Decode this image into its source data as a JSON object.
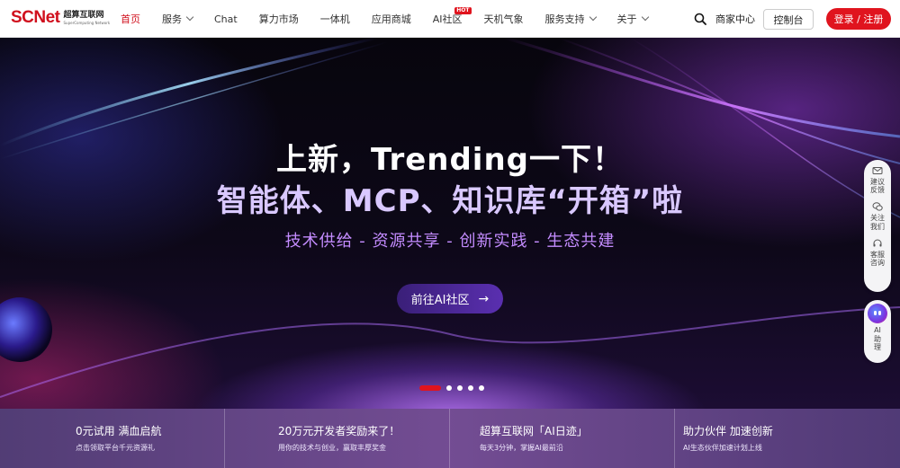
{
  "header": {
    "logo_mark": "SCNet",
    "logo_cn": "超算互联网",
    "logo_en": "SuperComputing Network",
    "nav": [
      {
        "label": "首页",
        "active": true,
        "dropdown": false
      },
      {
        "label": "服务",
        "active": false,
        "dropdown": true
      },
      {
        "label": "Chat",
        "active": false,
        "dropdown": false
      },
      {
        "label": "算力市场",
        "active": false,
        "dropdown": false
      },
      {
        "label": "一体机",
        "active": false,
        "dropdown": false
      },
      {
        "label": "应用商城",
        "active": false,
        "dropdown": false
      },
      {
        "label": "AI社区",
        "active": false,
        "dropdown": false,
        "badge": "HOT"
      },
      {
        "label": "天机气象",
        "active": false,
        "dropdown": false
      },
      {
        "label": "服务支持",
        "active": false,
        "dropdown": true
      },
      {
        "label": "关于",
        "active": false,
        "dropdown": true
      }
    ],
    "merchant_label": "商家中心",
    "console_label": "控制台",
    "login_label": "登录 / 注册"
  },
  "hero": {
    "title_line1": "上新，Trending一下！",
    "title_line2": "智能体、MCP、知识库“开箱”啦",
    "subtitle": "技术供给 - 资源共享 - 创新实践 - 生态共建",
    "cta_label": "前往AI社区",
    "cta_arrow": "→",
    "slide_count": 5,
    "active_slide": 1
  },
  "rail": {
    "items": [
      {
        "label": "建议反馈",
        "icon": "mail-icon"
      },
      {
        "label": "关注我们",
        "icon": "wechat-icon"
      },
      {
        "label": "客服咨询",
        "icon": "headset-icon"
      }
    ],
    "ai_label": "AI助理"
  },
  "promo": [
    {
      "title": "0元试用 满血启航",
      "desc": "点击领取平台千元资源礼"
    },
    {
      "title": "20万元开发者奖励来了！",
      "desc": "用你的技术与创业，赢取丰厚奖金"
    },
    {
      "title": "超算互联网「AI日迹」",
      "desc": "每天3分钟，掌握AI最前沿"
    },
    {
      "title": "助力伙伴 加速创新",
      "desc": "AI生态伙伴加速计划上线"
    }
  ],
  "colors": {
    "brand_red": "#e0141e",
    "hero_title": "#ffffff",
    "hero_title2": "#d9c8ff",
    "hero_subtitle": "#c48cff"
  }
}
